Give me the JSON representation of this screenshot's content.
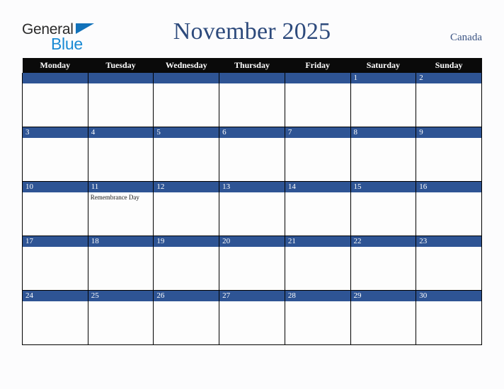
{
  "brand": {
    "name_part1": "General",
    "name_part2": "Blue",
    "triangle_icon": "blue-triangle-icon",
    "color_dark": "#2b2b2b",
    "color_blue": "#1a8ad4"
  },
  "header": {
    "title": "November 2025",
    "country": "Canada",
    "title_color": "#2d4a7c"
  },
  "calendar": {
    "accent_color": "#2e5494",
    "header_bg": "#0a0a0a",
    "weekday_headers": [
      "Monday",
      "Tuesday",
      "Wednesday",
      "Thursday",
      "Friday",
      "Saturday",
      "Sunday"
    ],
    "weeks": [
      [
        {
          "date": "",
          "events": []
        },
        {
          "date": "",
          "events": []
        },
        {
          "date": "",
          "events": []
        },
        {
          "date": "",
          "events": []
        },
        {
          "date": "",
          "events": []
        },
        {
          "date": "1",
          "events": []
        },
        {
          "date": "2",
          "events": []
        }
      ],
      [
        {
          "date": "3",
          "events": []
        },
        {
          "date": "4",
          "events": []
        },
        {
          "date": "5",
          "events": []
        },
        {
          "date": "6",
          "events": []
        },
        {
          "date": "7",
          "events": []
        },
        {
          "date": "8",
          "events": []
        },
        {
          "date": "9",
          "events": []
        }
      ],
      [
        {
          "date": "10",
          "events": []
        },
        {
          "date": "11",
          "events": [
            "Remembrance Day"
          ]
        },
        {
          "date": "12",
          "events": []
        },
        {
          "date": "13",
          "events": []
        },
        {
          "date": "14",
          "events": []
        },
        {
          "date": "15",
          "events": []
        },
        {
          "date": "16",
          "events": []
        }
      ],
      [
        {
          "date": "17",
          "events": []
        },
        {
          "date": "18",
          "events": []
        },
        {
          "date": "19",
          "events": []
        },
        {
          "date": "20",
          "events": []
        },
        {
          "date": "21",
          "events": []
        },
        {
          "date": "22",
          "events": []
        },
        {
          "date": "23",
          "events": []
        }
      ],
      [
        {
          "date": "24",
          "events": []
        },
        {
          "date": "25",
          "events": []
        },
        {
          "date": "26",
          "events": []
        },
        {
          "date": "27",
          "events": []
        },
        {
          "date": "28",
          "events": []
        },
        {
          "date": "29",
          "events": []
        },
        {
          "date": "30",
          "events": []
        }
      ]
    ]
  }
}
